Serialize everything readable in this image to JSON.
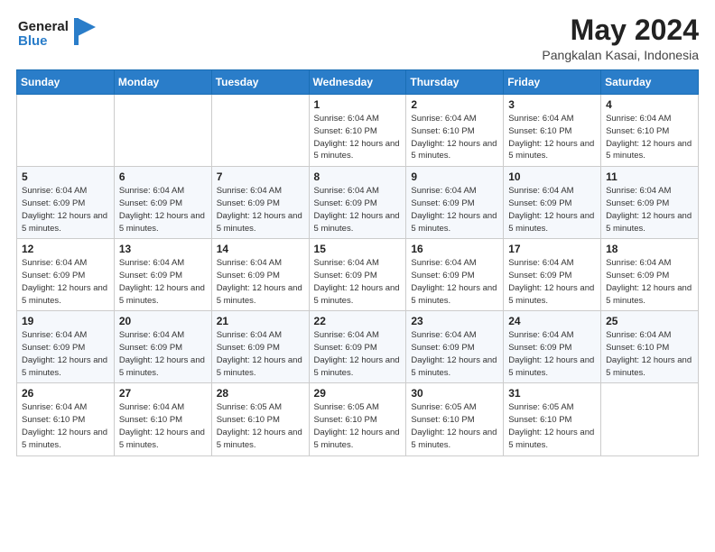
{
  "header": {
    "logo_line1": "General",
    "logo_line2": "Blue",
    "title": "May 2024",
    "subtitle": "Pangkalan Kasai, Indonesia"
  },
  "weekdays": [
    "Sunday",
    "Monday",
    "Tuesday",
    "Wednesday",
    "Thursday",
    "Friday",
    "Saturday"
  ],
  "weeks": [
    [
      {
        "day": "",
        "sunrise": "",
        "sunset": "",
        "daylight": ""
      },
      {
        "day": "",
        "sunrise": "",
        "sunset": "",
        "daylight": ""
      },
      {
        "day": "",
        "sunrise": "",
        "sunset": "",
        "daylight": ""
      },
      {
        "day": "1",
        "sunrise": "Sunrise: 6:04 AM",
        "sunset": "Sunset: 6:10 PM",
        "daylight": "Daylight: 12 hours and 5 minutes."
      },
      {
        "day": "2",
        "sunrise": "Sunrise: 6:04 AM",
        "sunset": "Sunset: 6:10 PM",
        "daylight": "Daylight: 12 hours and 5 minutes."
      },
      {
        "day": "3",
        "sunrise": "Sunrise: 6:04 AM",
        "sunset": "Sunset: 6:10 PM",
        "daylight": "Daylight: 12 hours and 5 minutes."
      },
      {
        "day": "4",
        "sunrise": "Sunrise: 6:04 AM",
        "sunset": "Sunset: 6:10 PM",
        "daylight": "Daylight: 12 hours and 5 minutes."
      }
    ],
    [
      {
        "day": "5",
        "sunrise": "Sunrise: 6:04 AM",
        "sunset": "Sunset: 6:09 PM",
        "daylight": "Daylight: 12 hours and 5 minutes."
      },
      {
        "day": "6",
        "sunrise": "Sunrise: 6:04 AM",
        "sunset": "Sunset: 6:09 PM",
        "daylight": "Daylight: 12 hours and 5 minutes."
      },
      {
        "day": "7",
        "sunrise": "Sunrise: 6:04 AM",
        "sunset": "Sunset: 6:09 PM",
        "daylight": "Daylight: 12 hours and 5 minutes."
      },
      {
        "day": "8",
        "sunrise": "Sunrise: 6:04 AM",
        "sunset": "Sunset: 6:09 PM",
        "daylight": "Daylight: 12 hours and 5 minutes."
      },
      {
        "day": "9",
        "sunrise": "Sunrise: 6:04 AM",
        "sunset": "Sunset: 6:09 PM",
        "daylight": "Daylight: 12 hours and 5 minutes."
      },
      {
        "day": "10",
        "sunrise": "Sunrise: 6:04 AM",
        "sunset": "Sunset: 6:09 PM",
        "daylight": "Daylight: 12 hours and 5 minutes."
      },
      {
        "day": "11",
        "sunrise": "Sunrise: 6:04 AM",
        "sunset": "Sunset: 6:09 PM",
        "daylight": "Daylight: 12 hours and 5 minutes."
      }
    ],
    [
      {
        "day": "12",
        "sunrise": "Sunrise: 6:04 AM",
        "sunset": "Sunset: 6:09 PM",
        "daylight": "Daylight: 12 hours and 5 minutes."
      },
      {
        "day": "13",
        "sunrise": "Sunrise: 6:04 AM",
        "sunset": "Sunset: 6:09 PM",
        "daylight": "Daylight: 12 hours and 5 minutes."
      },
      {
        "day": "14",
        "sunrise": "Sunrise: 6:04 AM",
        "sunset": "Sunset: 6:09 PM",
        "daylight": "Daylight: 12 hours and 5 minutes."
      },
      {
        "day": "15",
        "sunrise": "Sunrise: 6:04 AM",
        "sunset": "Sunset: 6:09 PM",
        "daylight": "Daylight: 12 hours and 5 minutes."
      },
      {
        "day": "16",
        "sunrise": "Sunrise: 6:04 AM",
        "sunset": "Sunset: 6:09 PM",
        "daylight": "Daylight: 12 hours and 5 minutes."
      },
      {
        "day": "17",
        "sunrise": "Sunrise: 6:04 AM",
        "sunset": "Sunset: 6:09 PM",
        "daylight": "Daylight: 12 hours and 5 minutes."
      },
      {
        "day": "18",
        "sunrise": "Sunrise: 6:04 AM",
        "sunset": "Sunset: 6:09 PM",
        "daylight": "Daylight: 12 hours and 5 minutes."
      }
    ],
    [
      {
        "day": "19",
        "sunrise": "Sunrise: 6:04 AM",
        "sunset": "Sunset: 6:09 PM",
        "daylight": "Daylight: 12 hours and 5 minutes."
      },
      {
        "day": "20",
        "sunrise": "Sunrise: 6:04 AM",
        "sunset": "Sunset: 6:09 PM",
        "daylight": "Daylight: 12 hours and 5 minutes."
      },
      {
        "day": "21",
        "sunrise": "Sunrise: 6:04 AM",
        "sunset": "Sunset: 6:09 PM",
        "daylight": "Daylight: 12 hours and 5 minutes."
      },
      {
        "day": "22",
        "sunrise": "Sunrise: 6:04 AM",
        "sunset": "Sunset: 6:09 PM",
        "daylight": "Daylight: 12 hours and 5 minutes."
      },
      {
        "day": "23",
        "sunrise": "Sunrise: 6:04 AM",
        "sunset": "Sunset: 6:09 PM",
        "daylight": "Daylight: 12 hours and 5 minutes."
      },
      {
        "day": "24",
        "sunrise": "Sunrise: 6:04 AM",
        "sunset": "Sunset: 6:09 PM",
        "daylight": "Daylight: 12 hours and 5 minutes."
      },
      {
        "day": "25",
        "sunrise": "Sunrise: 6:04 AM",
        "sunset": "Sunset: 6:10 PM",
        "daylight": "Daylight: 12 hours and 5 minutes."
      }
    ],
    [
      {
        "day": "26",
        "sunrise": "Sunrise: 6:04 AM",
        "sunset": "Sunset: 6:10 PM",
        "daylight": "Daylight: 12 hours and 5 minutes."
      },
      {
        "day": "27",
        "sunrise": "Sunrise: 6:04 AM",
        "sunset": "Sunset: 6:10 PM",
        "daylight": "Daylight: 12 hours and 5 minutes."
      },
      {
        "day": "28",
        "sunrise": "Sunrise: 6:05 AM",
        "sunset": "Sunset: 6:10 PM",
        "daylight": "Daylight: 12 hours and 5 minutes."
      },
      {
        "day": "29",
        "sunrise": "Sunrise: 6:05 AM",
        "sunset": "Sunset: 6:10 PM",
        "daylight": "Daylight: 12 hours and 5 minutes."
      },
      {
        "day": "30",
        "sunrise": "Sunrise: 6:05 AM",
        "sunset": "Sunset: 6:10 PM",
        "daylight": "Daylight: 12 hours and 5 minutes."
      },
      {
        "day": "31",
        "sunrise": "Sunrise: 6:05 AM",
        "sunset": "Sunset: 6:10 PM",
        "daylight": "Daylight: 12 hours and 5 minutes."
      },
      {
        "day": "",
        "sunrise": "",
        "sunset": "",
        "daylight": ""
      }
    ]
  ]
}
